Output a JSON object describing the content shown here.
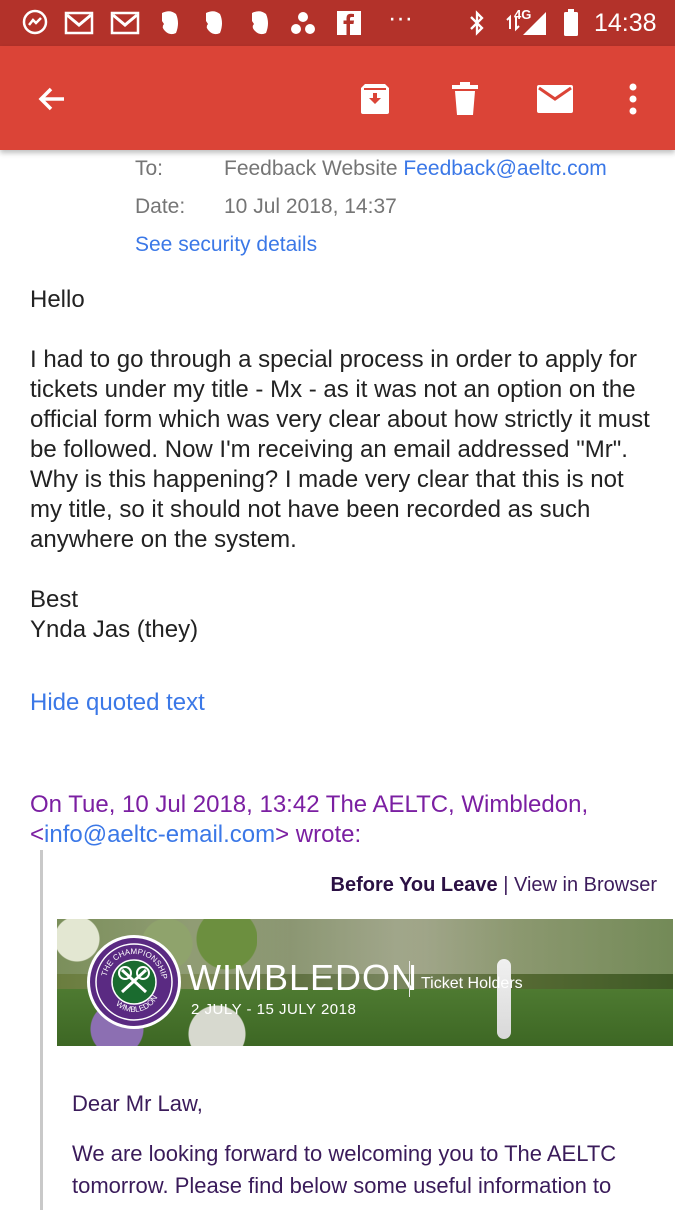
{
  "status_bar": {
    "network": "4G",
    "time": "14:38",
    "notification_icons": [
      "messenger-icon",
      "gmail-icon",
      "gmail-icon",
      "evernote-icon",
      "evernote-icon",
      "evernote-icon",
      "cluster-icon",
      "facebook-icon",
      "more-notifications-icon"
    ],
    "more_dots": "···"
  },
  "app_bar": {
    "actions": [
      "back-arrow-icon",
      "archive-icon",
      "delete-icon",
      "mark-unread-icon",
      "overflow-menu-icon"
    ]
  },
  "headers": {
    "to_label": "To:",
    "to_name": "Feedback Website",
    "to_email": "Feedback@aeltc.com",
    "date_label": "Date:",
    "date_value": "10 Jul 2018, 14:37",
    "security_link": "See security details"
  },
  "message": {
    "greeting": "Hello",
    "paragraph": "I had to go through a special process in order to apply for tickets under my title - Mx - as it was not an option on the official form which was very clear about how strictly it must be followed. Now I'm receiving an email addressed \"Mr\". Why is this happening? I made very clear that this is not my title, so it should not have been recorded as such anywhere on the system.",
    "signoff": "Best",
    "signature": "Ynda Jas (they)",
    "hide_quoted": "Hide quoted text"
  },
  "quoted": {
    "header_prefix": "On Tue, 10 Jul 2018, 13:42 The AELTC, Wimbledon, <",
    "header_email": "info@aeltc-email.com",
    "header_suffix": "> wrote:",
    "before_you_leave": "Before You Leave",
    "separator": "|",
    "view_in_browser": "View in Browser",
    "banner": {
      "crest_top": "THE CHAMPIONSHIPS",
      "crest_bottom": "WIMBLEDON",
      "title": "WIMBLEDON",
      "dates": "2 JULY - 15 JULY 2018",
      "subtitle": "Ticket Holders"
    },
    "salutation": "Dear Mr Law,",
    "body": "We are looking forward to welcoming you to The AELTC tomorrow. Please find below some useful information to"
  },
  "colors": {
    "status_bar": "#b3322a",
    "app_bar": "#db4437",
    "link": "#3b78e7",
    "quote_header": "#7b1fa2",
    "email_text": "#3a1b5a"
  }
}
